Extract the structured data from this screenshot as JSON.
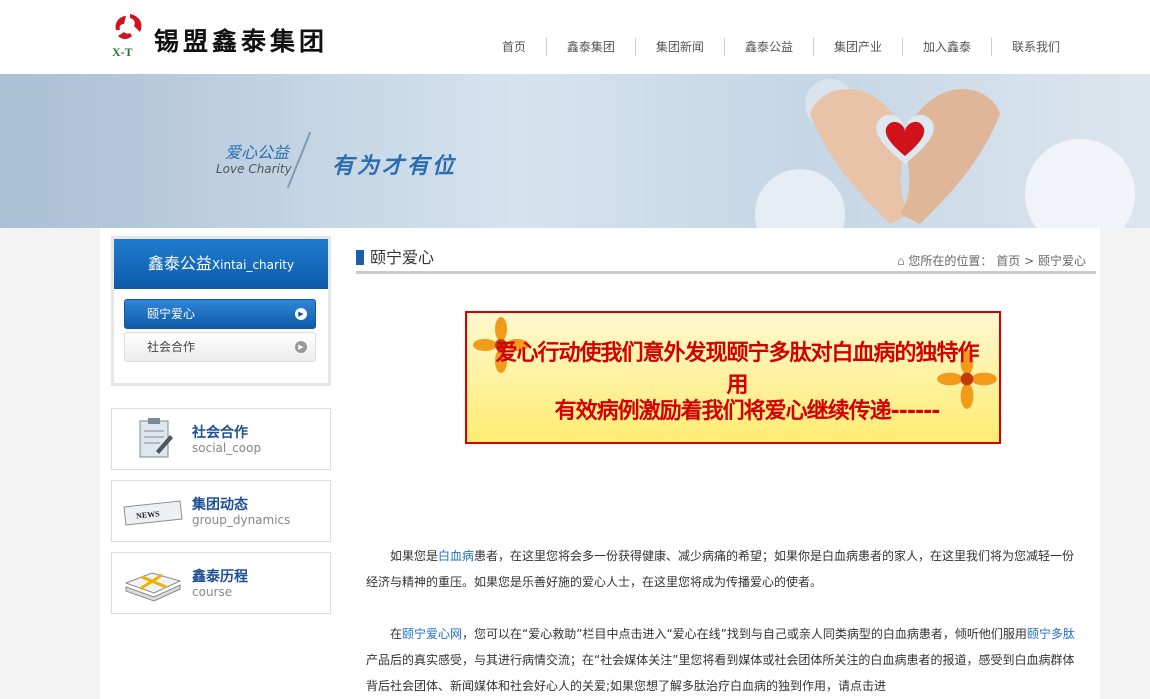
{
  "header": {
    "logo_text": "锡盟鑫泰集团",
    "logo_mark": "X-T",
    "nav": [
      "首页",
      "鑫泰集团",
      "集团新闻",
      "鑫泰公益",
      "集团产业",
      "加入鑫泰",
      "联系我们"
    ]
  },
  "banner": {
    "category_cn": "爱心公益",
    "category_en": "Love Charity",
    "slogan": "有为才有位"
  },
  "sidebar": {
    "title": "鑫泰公益",
    "title_en": "Xintai_charity",
    "items": [
      {
        "label": "颐宁爱心",
        "active": true
      },
      {
        "label": "社会合作",
        "active": false
      }
    ],
    "cards": [
      {
        "title": "社会合作",
        "sub": "social_coop",
        "icon": "clipboard-icon"
      },
      {
        "title": "集团动态",
        "sub": "group_dynamics",
        "icon": "newspaper-icon"
      },
      {
        "title": "鑫泰历程",
        "sub": "course",
        "icon": "papers-stack-icon"
      }
    ]
  },
  "main": {
    "title": "颐宁爱心",
    "breadcrumb": {
      "prefix": "您所在的位置：",
      "home": "首页",
      "sep": ">",
      "current": "颐宁爱心"
    },
    "feature": {
      "line1": "爱心行动使我们意外发现颐宁多肽对白血病的独特作用",
      "line2": "有效病例激励着我们将爱心继续传递------"
    },
    "p1": {
      "a": "如果您是",
      "link": "白血病",
      "b": "患者，在这里您将会多一份获得健康、减少病痛的希望；如果你是白血病患者的家人，在这里我们将为您减轻一份经济与精神的重压。如果您是乐善好施的爱心人士，在这里您将成为传播爱心的使者。"
    },
    "p2": {
      "a": "在",
      "link1": "颐宁爱心网",
      "b": "，您可以在“爱心救助”栏目中点击进入“爱心在线”找到与自己或亲人同类病型的白血病患者，倾听他们服用",
      "link2": "颐宁多肽",
      "c": "产品后的真实感受，与其进行病情交流；在“社会媒体关注”里您将看到媒体或社会团体所关注的白血病患者的报道，感受到白血病群体背后社会团体、新闻媒体和社会好心人的关爱;如果您想了解多肽治疗白血病的独到作用，请点击进"
    }
  },
  "colors": {
    "accent": "#1c5ea8",
    "feature_border": "#d40000"
  }
}
